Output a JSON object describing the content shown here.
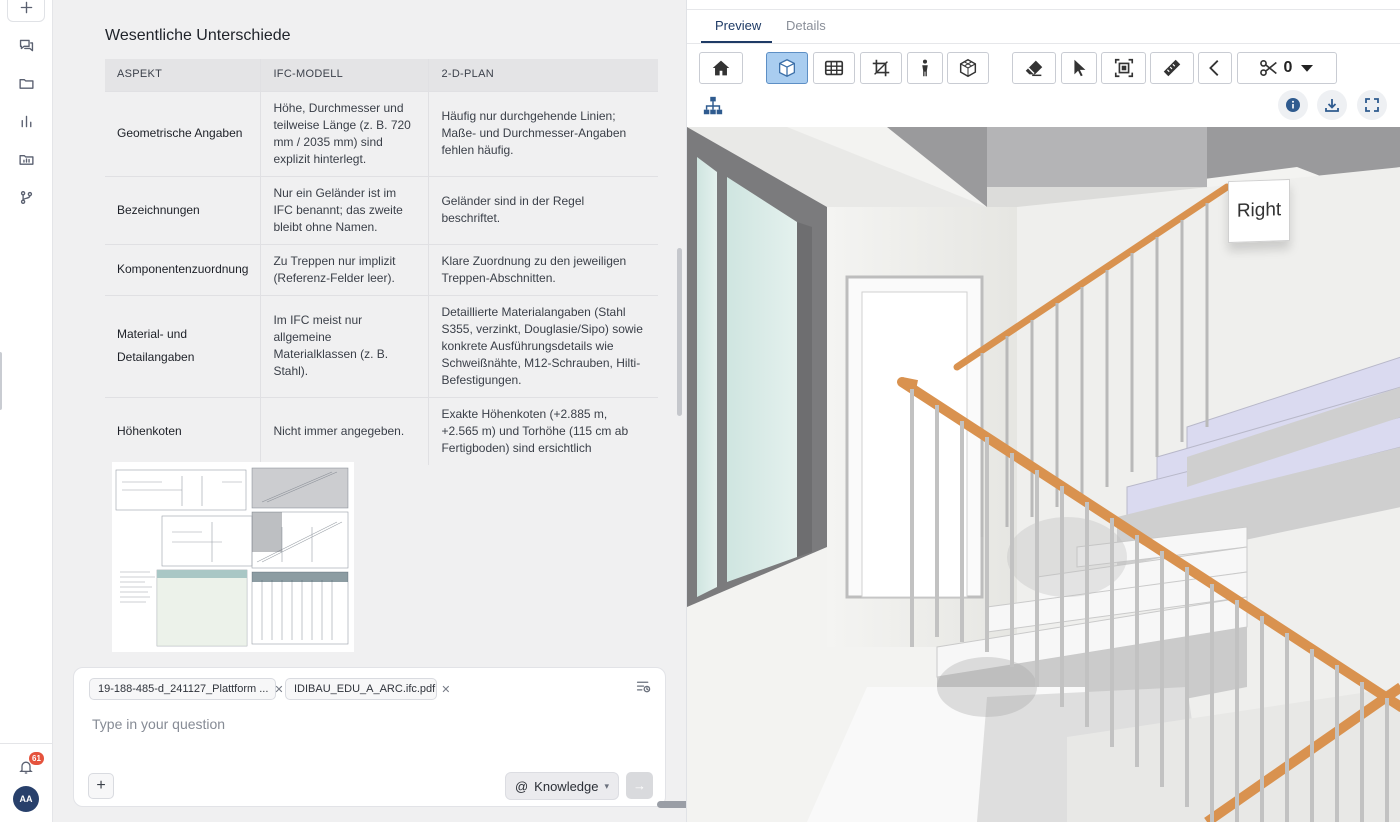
{
  "rail": {
    "items": [
      {
        "icon": "chat-bubbles-icon",
        "name": "rail-chats"
      },
      {
        "icon": "folder-icon",
        "name": "rail-files"
      },
      {
        "icon": "bar-chart-icon",
        "name": "rail-analytics"
      },
      {
        "icon": "project-folder-icon",
        "name": "rail-projects"
      },
      {
        "icon": "branch-icon",
        "name": "rail-workflows"
      }
    ],
    "notification_count": "61",
    "avatar_initials": "AA"
  },
  "chat": {
    "section_title": "Wesentliche Unterschiede",
    "table": {
      "headers": [
        "ASPEKT",
        "IFC-MODELL",
        "2-D-PLAN"
      ],
      "rows": [
        {
          "aspect": "Geometrische Angaben",
          "ifc": "Höhe, Durchmesser und teilweise Länge (z. B. 720 mm / 2035 mm) sind explizit hinterlegt.",
          "plan": "Häufig nur durchgehende Linien; Maße- und Durchmesser-Angaben fehlen häufig."
        },
        {
          "aspect": "Bezeichnungen",
          "ifc": "Nur ein Geländer ist im IFC benannt; das zweite bleibt ohne Namen.",
          "plan": "Geländer sind in der Regel beschriftet."
        },
        {
          "aspect": "Komponentenzuordnung",
          "ifc": "Zu Treppen nur implizit (Referenz-Felder leer).",
          "plan": "Klare Zuordnung zu den jeweiligen Treppen-Abschnitten."
        },
        {
          "aspect": "Material- und Detailangaben",
          "ifc": "Im IFC meist nur allgemeine Materialklassen (z. B. Stahl).",
          "plan": "Detaillierte Materialangaben (Stahl S355, verzinkt, Douglasie/Sipo) sowie konkrete Ausführungsdetails wie Schweißnähte, M12-Schrauben, Hilti-Befestigungen."
        },
        {
          "aspect": "Höhenkoten",
          "ifc": "Nicht immer angegeben.",
          "plan": "Exakte Höhenkoten (+2.885 m, +2.565 m) und Torhöhe (115 cm ab Fertigboden) sind ersichtlich"
        }
      ]
    },
    "composer": {
      "attachments": [
        {
          "label": "19-188-485-d_241127_Plattform ..."
        },
        {
          "label": "IDIBAU_EDU_A_ARC.ifc.pdf"
        }
      ],
      "placeholder": "Type in your question",
      "knowledge_label": "Knowledge"
    }
  },
  "viewer": {
    "tabs": [
      {
        "label": "Preview",
        "active": true
      },
      {
        "label": "Details",
        "active": false
      }
    ],
    "toolbar": {
      "buttons": [
        "home-icon",
        "3d-box-icon",
        "table-icon",
        "crop-icon",
        "person-icon",
        "section-box-icon",
        "eraser-icon",
        "cursor-icon",
        "frame-icon",
        "ruler-icon",
        "chevron-left-icon",
        "scissors-icon"
      ],
      "active": "3d-box-icon",
      "section_count": "0"
    },
    "navcube_label": "Right",
    "colors": {
      "accent": "#1f3b66",
      "active_button": "#a9cdf0",
      "railing": "#d9924f"
    }
  }
}
